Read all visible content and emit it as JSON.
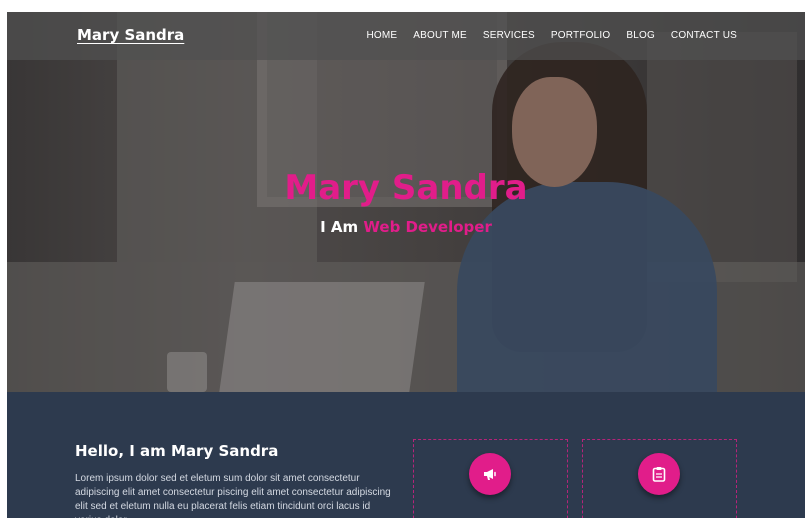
{
  "header": {
    "brand": "Mary Sandra",
    "nav": [
      "HOME",
      "ABOUT ME",
      "SERVICES",
      "PORTFOLIO",
      "BLOG",
      "CONTACT US"
    ]
  },
  "hero": {
    "title": "Mary Sandra",
    "subtitle_prefix": "I Am ",
    "subtitle_accent": "Web Developer"
  },
  "about": {
    "heading": "Hello, I am Mary Sandra",
    "text": "Lorem ipsum dolor sed et eletum sum dolor sit amet consectetur adipiscing elit amet consectetur piscing elit amet consectetur adipiscing elit sed et eletum nulla eu placerat felis etiam tincidunt orci lacus id varius dolor"
  },
  "services": [
    {
      "icon": "megaphone-icon"
    },
    {
      "icon": "clipboard-icon"
    }
  ],
  "colors": {
    "accent": "#e11d8a",
    "section_bg": "#2d3a4e",
    "nav_bg": "rgba(80,80,80,0.72)"
  }
}
